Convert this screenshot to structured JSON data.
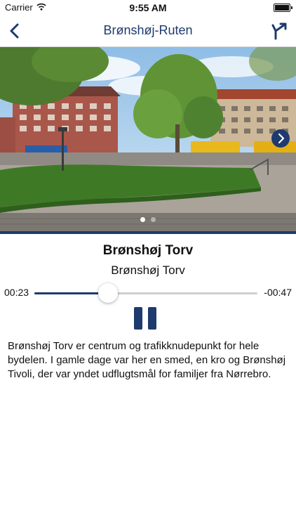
{
  "status_bar": {
    "carrier": "Carrier",
    "time": "9:55 AM"
  },
  "nav": {
    "title": "Brønshøj-Ruten",
    "back_icon": "chevron-left-icon",
    "route_icon": "route-fork-icon"
  },
  "carousel": {
    "page_count": 2,
    "current_page": 1,
    "next_icon": "chevron-right-icon"
  },
  "stop": {
    "title": "Brønshøj Torv",
    "subtitle": "Brønshøj Torv"
  },
  "player": {
    "elapsed": "00:23",
    "remaining": "-00:47",
    "progress": 0.33,
    "state_icon": "pause-icon"
  },
  "description": "Brønshøj Torv er centrum og trafikknudepunkt for hele bydelen. I gamle dage var her en smed, en kro og Brønshøj Tivoli, der var yndet udflugtsmål for familjer fra Nørrebro.",
  "colors": {
    "accent": "#1e3a6e"
  }
}
